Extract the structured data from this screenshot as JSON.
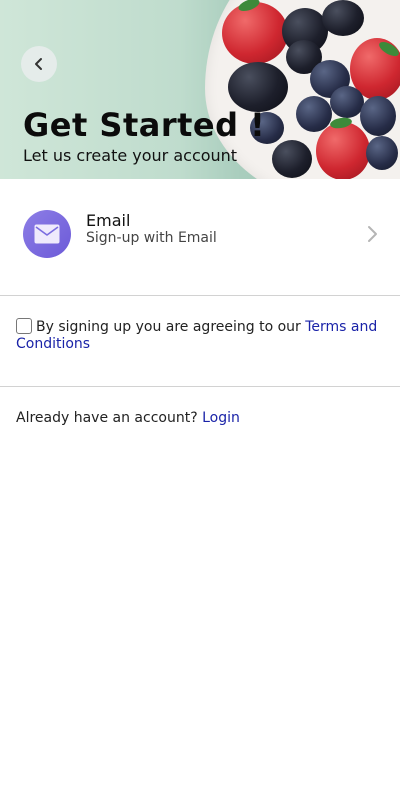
{
  "header": {
    "title": "Get Started !",
    "subtitle": "Let us create your account",
    "back_icon": "chevron-left-icon"
  },
  "signup_options": [
    {
      "icon": "envelope-icon",
      "title": "Email",
      "subtitle": "Sign-up with Email",
      "accent": "#7b6ce0"
    }
  ],
  "terms": {
    "checked": false,
    "prefix": "By signing up you are agreeing to our ",
    "link_text": "Terms and Conditions"
  },
  "login": {
    "prompt": "Already have an account? ",
    "link_text": "Login"
  },
  "colors": {
    "link": "#1a23a8",
    "avatar": "#7b6ce0",
    "divider": "#d2d2d2"
  }
}
